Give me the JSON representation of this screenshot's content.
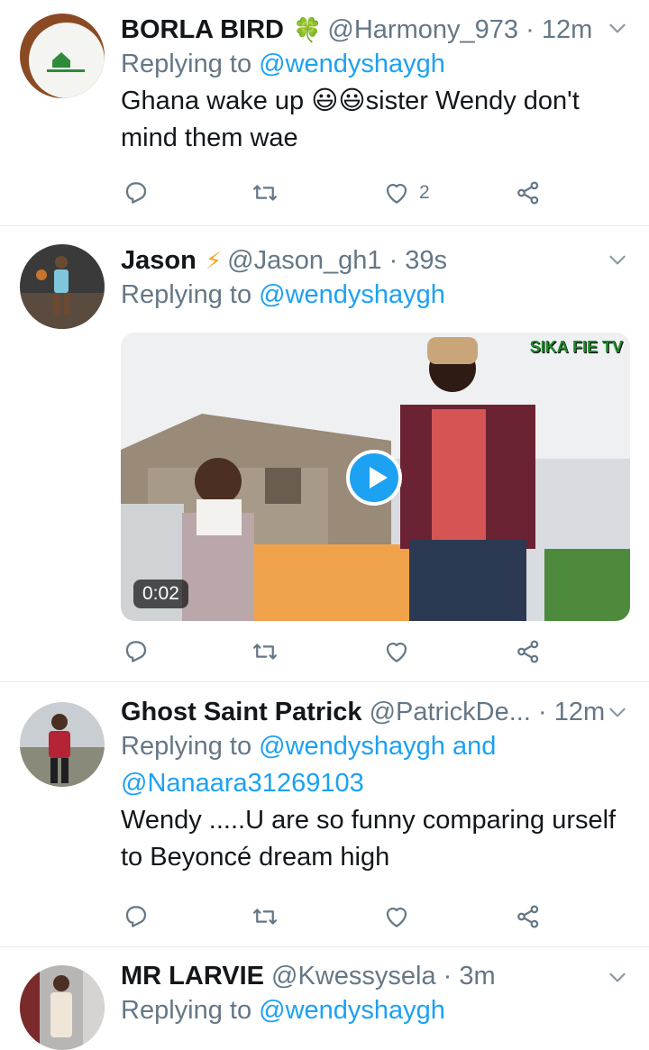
{
  "tweets": [
    {
      "name": "BORLA BIRD",
      "name_emoji": "🍀",
      "handle": "@Harmony_973",
      "dot": "·",
      "time": "12m",
      "replying_prefix": "Replying to",
      "replying_to": "@wendyshaygh",
      "text": "Ghana wake up 😃😃sister Wendy don't mind them wae",
      "likes": "2",
      "avatar_text": "BORLA BIRD"
    },
    {
      "name": "Jason",
      "name_emoji": "⚡",
      "handle": "@Jason_gh1",
      "dot": "·",
      "time": "39s",
      "replying_prefix": "Replying to",
      "replying_to": "@wendyshaygh",
      "video_duration": "0:02",
      "video_watermark": "SIKA FIE TV"
    },
    {
      "name": "Ghost Saint Patrick",
      "handle": "@PatrickDe...",
      "dot": "·",
      "time": "12m",
      "replying_prefix": "Replying to",
      "replying_to": "@wendyshaygh and",
      "replying_to_2": "@Nanaara31269103",
      "text": "Wendy .....U are so funny comparing urself to Beyoncé dream high"
    },
    {
      "name": "MR LARVIE",
      "handle": "@Kwessysela",
      "dot": "·",
      "time": "3m",
      "replying_prefix": "Replying to",
      "replying_to": "@wendyshaygh"
    }
  ],
  "colors": {
    "accent": "#1da1f2",
    "secondary_text": "#657786",
    "divider": "#e6ecf0"
  }
}
